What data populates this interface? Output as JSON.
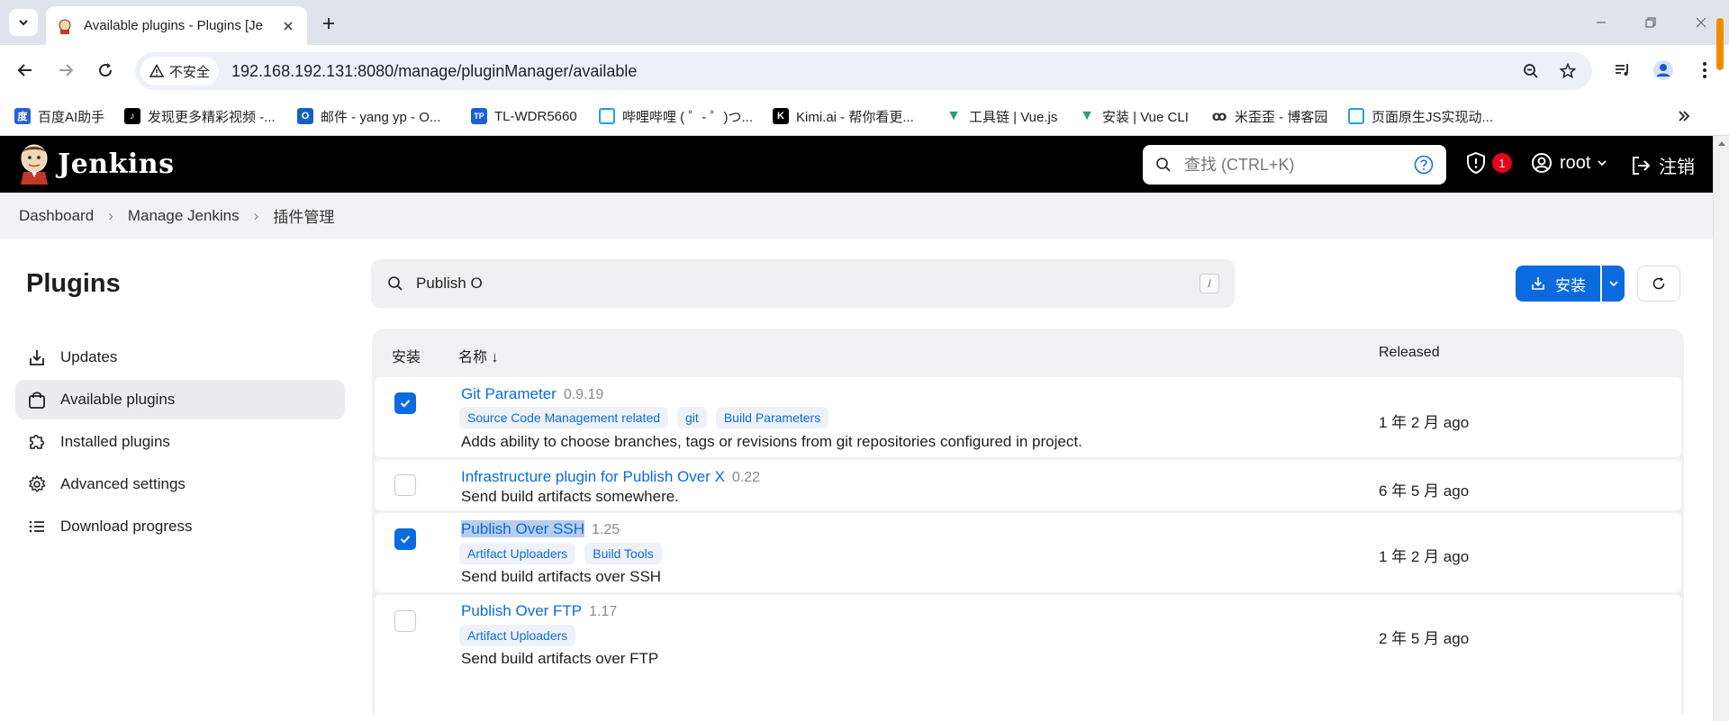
{
  "browser": {
    "tab": {
      "title": "Available plugins - Plugins [Je"
    },
    "address": {
      "security_label": "不安全",
      "url": "192.168.192.131:8080/manage/pluginManager/available"
    },
    "bookmarks": [
      {
        "label": "百度AI助手",
        "icon": "baidu-icon",
        "color": "#2b5fd9"
      },
      {
        "label": "发现更多精彩视频 -...",
        "icon": "tiktok-icon",
        "color": "#000000"
      },
      {
        "label": "邮件 - yang yp - O...",
        "icon": "outlook-icon",
        "color": "#1560c5"
      },
      {
        "label": "TL-WDR5660",
        "icon": "tplink-icon",
        "color": "#1a61d6"
      },
      {
        "label": "哔哩哔哩 ( ゜- ゜)つ...",
        "icon": "bilibili-icon",
        "color": "#1da1e3"
      },
      {
        "label": "Kimi.ai - 帮你看更...",
        "icon": "kimi-icon",
        "color": "#000000"
      },
      {
        "label": "工具链 | Vue.js",
        "icon": "vue-icon",
        "color": "#2f9f6e"
      },
      {
        "label": "安装 | Vue CLI",
        "icon": "vue-icon",
        "color": "#2f9f6e"
      },
      {
        "label": "米歪歪 - 博客园",
        "icon": "cnblogs-icon",
        "color": "#333333"
      },
      {
        "label": "页面原生JS实现动...",
        "icon": "bilibili-icon",
        "color": "#1da1e3"
      }
    ]
  },
  "jenkins": {
    "brand": "Jenkins",
    "search_placeholder": "查找 (CTRL+K)",
    "alert_count": "1",
    "user": "root",
    "logout": "注销"
  },
  "breadcrumb": [
    "Dashboard",
    "Manage Jenkins",
    "插件管理"
  ],
  "page_title": "Plugins",
  "sidebar": [
    {
      "label": "Updates",
      "icon": "download-icon",
      "active": false
    },
    {
      "label": "Available plugins",
      "icon": "shopping-bag-icon",
      "active": true
    },
    {
      "label": "Installed plugins",
      "icon": "puzzle-icon",
      "active": false
    },
    {
      "label": "Advanced settings",
      "icon": "gear-icon",
      "active": false
    },
    {
      "label": "Download progress",
      "icon": "list-icon",
      "active": false
    }
  ],
  "filter": {
    "value": "Publish O",
    "shortcut": "/"
  },
  "actions": {
    "install": "安装"
  },
  "table": {
    "headers": {
      "install": "安装",
      "name": "名称 ↓",
      "released": "Released"
    },
    "rows": [
      {
        "name": "Git Parameter",
        "version": "0.9.19",
        "checked": true,
        "tags": [
          "Source Code Management related",
          "git",
          "Build Parameters"
        ],
        "description": "Adds ability to choose branches, tags or revisions from git repositories configured in project.",
        "released": "1 年 2 月 ago"
      },
      {
        "name": "Infrastructure plugin for Publish Over X",
        "version": "0.22",
        "checked": false,
        "tags": [],
        "description": "Send build artifacts somewhere.",
        "released": "6 年 5 月 ago"
      },
      {
        "name": "Publish Over SSH",
        "version": "1.25",
        "checked": true,
        "highlighted": true,
        "tags": [
          "Artifact Uploaders",
          "Build Tools"
        ],
        "description": "Send build artifacts over SSH",
        "released": "1 年 2 月 ago"
      },
      {
        "name": "Publish Over FTP",
        "version": "1.17",
        "checked": false,
        "tags": [
          "Artifact Uploaders"
        ],
        "description": "Send build artifacts over FTP",
        "released": "2 年 5 月 ago"
      }
    ]
  },
  "colors": {
    "accent": "#0b6bde",
    "header_bg": "#000000",
    "badge": "#e6001f"
  }
}
